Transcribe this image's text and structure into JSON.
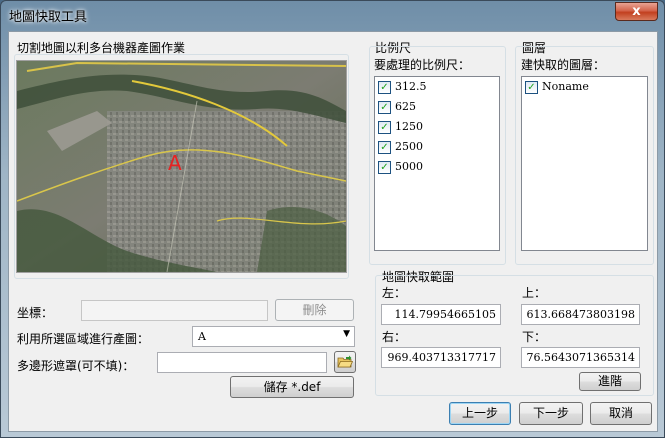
{
  "window": {
    "title": "地圖快取工具",
    "close_label": "x"
  },
  "map_panel": {
    "heading": "切割地圖以利多台機器產圖作業",
    "marker_label": "A"
  },
  "coordinates": {
    "label": "坐標：",
    "value": "",
    "delete_label": "刪除"
  },
  "region": {
    "label": "利用所選區域進行產圖：",
    "selected": "A"
  },
  "polygon_mask": {
    "label": "多邊形遮罩(可不填)：",
    "value": "",
    "save_label": "儲存 *.def"
  },
  "scale": {
    "group_title": "比例尺",
    "list_label": "要處理的比例尺：",
    "items": [
      {
        "label": "312.5",
        "checked": true
      },
      {
        "label": "625",
        "checked": true
      },
      {
        "label": "1250",
        "checked": true
      },
      {
        "label": "2500",
        "checked": true
      },
      {
        "label": "5000",
        "checked": true
      }
    ]
  },
  "layers": {
    "group_title": "圖層",
    "list_label": "建快取的圖層：",
    "items": [
      {
        "label": "Noname",
        "checked": true
      }
    ]
  },
  "extent": {
    "group_title": "地圖快取範圍",
    "left_label": "左：",
    "left_value": "114.79954665105",
    "top_label": "上：",
    "top_value": "613.668473803198",
    "right_label": "右：",
    "right_value": "969.403713317717",
    "bottom_label": "下：",
    "bottom_value": "76.5643071365314",
    "advanced_label": "進階"
  },
  "footer": {
    "prev_label": "上一步",
    "next_label": "下一步",
    "cancel_label": "取消"
  }
}
